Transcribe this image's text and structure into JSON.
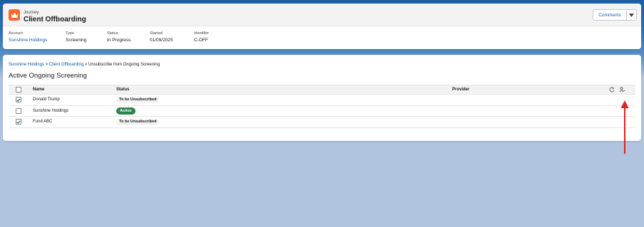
{
  "header": {
    "eyebrow": "Journey",
    "title": "Client Offboarding",
    "comments_label": "Comments",
    "fields": [
      {
        "label": "Account",
        "value": "Sunshine Holdings"
      },
      {
        "label": "Type",
        "value": "Screening"
      },
      {
        "label": "Status",
        "value": "In Progress"
      },
      {
        "label": "Started",
        "value": "01/09/2025"
      },
      {
        "label": "Identifier",
        "value": "C-OFF"
      }
    ]
  },
  "breadcrumb": {
    "items": [
      "Sunshine Holdings",
      "Client Offboarding"
    ],
    "separator": ">",
    "current": "Unsubscribe from Ongoing Screening"
  },
  "section": {
    "title": "Active Ongoing Screening"
  },
  "table": {
    "columns": [
      "Name",
      "Status",
      "Provider"
    ],
    "rows": [
      {
        "name": "Donald Trump",
        "status": "To be Unsubscribed",
        "checked": true
      },
      {
        "name": "Sunshine Holdings",
        "status": "Active",
        "checked": false
      },
      {
        "name": "Fund ABC",
        "status": "To be Unsubscribed",
        "checked": true
      }
    ]
  },
  "icons": {
    "app": "crown-icon",
    "refresh": "refresh-icon",
    "unsubscribe": "user-remove-icon",
    "dropdown": "chevron-down-icon"
  },
  "colors": {
    "brand": "#f26b2d",
    "link": "#0b5cab",
    "active_badge": "#2e844a",
    "annotation_arrow": "#e02020"
  }
}
